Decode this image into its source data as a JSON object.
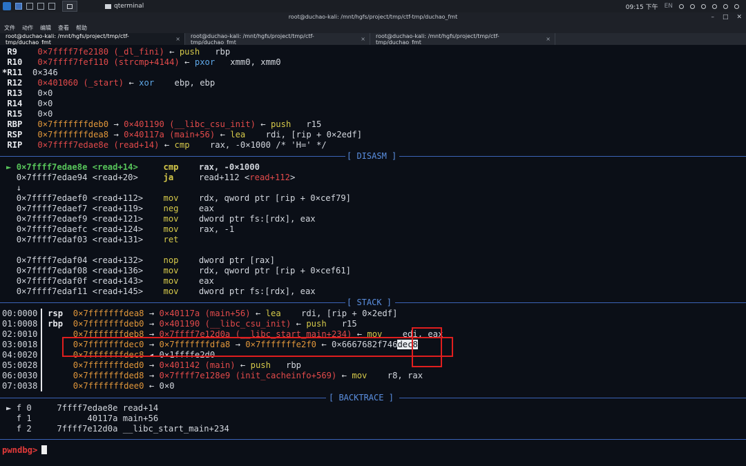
{
  "panel": {
    "task_title": "qterminal",
    "time": "09:15 下午",
    "lang": "EN"
  },
  "window": {
    "title": "root@duchao-kali: /mnt/hgfs/project/tmp/ctf-tmp/duchao_fmt",
    "menu": [
      "文件",
      "动作",
      "编辑",
      "查看",
      "帮助"
    ],
    "tabs": [
      {
        "label": "root@duchao-kali: /mnt/hgfs/project/tmp/ctf-tmp/duchao_fmt",
        "active": true
      },
      {
        "label": "root@duchao-kali: /mnt/hgfs/project/tmp/ctf-tmp/duchao_fmt",
        "active": false
      },
      {
        "label": "root@duchao-kali: /mnt/hgfs/project/tmp/ctf-tmp/duchao_fmt",
        "active": false
      }
    ],
    "close_glyph": "×"
  },
  "registers": [
    {
      "mark": " ",
      "name": "R9 ",
      "value": "0×7ffff7fe2180 (_dl_fini)",
      "arrow": "←",
      "op": "push",
      "args": "rbp"
    },
    {
      "mark": " ",
      "name": "R10",
      "value": "0×7ffff7fef110 (strcmp+4144)",
      "arrow": "←",
      "op": "pxor",
      "args": "xmm0, xmm0"
    },
    {
      "mark": "*",
      "name": "R11",
      "value": "0×346"
    },
    {
      "mark": " ",
      "name": "R12",
      "value": "0×401060 (_start)",
      "arrow": "←",
      "op": "xor",
      "args": "ebp, ebp"
    },
    {
      "mark": " ",
      "name": "R13",
      "value": "0×0"
    },
    {
      "mark": " ",
      "name": "R14",
      "value": "0×0"
    },
    {
      "mark": " ",
      "name": "R15",
      "value": "0×0"
    },
    {
      "mark": " ",
      "name": "RBP",
      "value": "0×7fffffffdeb0",
      "arrow": "→",
      "value2": "0×401190 (__libc_csu_init)",
      "arrow2": "←",
      "op": "push",
      "args": "r15"
    },
    {
      "mark": " ",
      "name": "RSP",
      "value": "0×7fffffffdea8",
      "arrow": "→",
      "value2": "0×40117a (main+56)",
      "arrow2": "←",
      "op": "lea",
      "args": "rdi, [rip + 0×2edf]"
    },
    {
      "mark": " ",
      "name": "RIP",
      "value": "0×7ffff7edae8e (read+14)",
      "arrow": "←",
      "op": "cmp",
      "args": "rax, -0×1000 /* 'H=' */"
    }
  ],
  "sections": {
    "disasm": "[ DISASM ]",
    "stack": "[ STACK ]",
    "backtrace": "[ BACKTRACE ]"
  },
  "disasm": [
    {
      "current": true,
      "addr": "0×7ffff7edae8e",
      "sym": "<read+14>",
      "op": "cmp",
      "args": "rax, -0×1000"
    },
    {
      "addr": "0×7ffff7edae94",
      "sym": "<read+20>",
      "op": "ja",
      "args": "read+112",
      "target": "<read+112>"
    },
    {
      "down": "↓"
    },
    {
      "addr": "0×7ffff7edaef0",
      "sym": "<read+112>",
      "op": "mov",
      "args": "rdx, qword ptr [rip + 0×cef79]"
    },
    {
      "addr": "0×7ffff7edaef7",
      "sym": "<read+119>",
      "op": "neg",
      "args": "eax"
    },
    {
      "addr": "0×7ffff7edaef9",
      "sym": "<read+121>",
      "op": "mov",
      "args": "dword ptr fs:[rdx], eax"
    },
    {
      "addr": "0×7ffff7edaefc",
      "sym": "<read+124>",
      "op": "mov",
      "args": "rax, -1"
    },
    {
      "addr": "0×7ffff7edaf03",
      "sym": "<read+131>",
      "op": "ret",
      "args": ""
    },
    {
      "blank": true
    },
    {
      "addr": "0×7ffff7edaf04",
      "sym": "<read+132>",
      "op": "nop",
      "args": "dword ptr [rax]"
    },
    {
      "addr": "0×7ffff7edaf08",
      "sym": "<read+136>",
      "op": "mov",
      "args": "rdx, qword ptr [rip + 0×cef61]"
    },
    {
      "addr": "0×7ffff7edaf0f",
      "sym": "<read+143>",
      "op": "mov",
      "args": "eax"
    },
    {
      "addr": "0×7ffff7edaf11",
      "sym": "<read+145>",
      "op": "mov",
      "args": "dword ptr fs:[rdx], eax"
    }
  ],
  "stack": [
    {
      "idx": "00:0000",
      "reg": "rsp",
      "addr": "0×7fffffffdea8",
      "a1": "→",
      "v1": "0×40117a (main+56)",
      "a2": "←",
      "op": "lea",
      "args": "rdi, [rip + 0×2edf]"
    },
    {
      "idx": "01:0008",
      "reg": "rbp",
      "addr": "0×7fffffffdeb0",
      "a1": "→",
      "v1": "0×401190 (__libc_csu_init)",
      "a2": "←",
      "op": "push",
      "args": "r15"
    },
    {
      "idx": "02:0010",
      "reg": "",
      "addr": "0×7fffffffdeb8",
      "a1": "→",
      "v1": "0×7ffff7e12d0a (__libc_start_main+234)",
      "a2": "←",
      "op": "mov",
      "args": "edi, eax"
    },
    {
      "idx": "03:0018",
      "reg": "",
      "addr": "0×7fffffffdec0",
      "a1": "→",
      "v1": "0×7fffffffdfa8",
      "a2": "→",
      "v2": "0×7fffffffe2f0",
      "a3": "←",
      "v3": "0×6667682f746",
      "sel": "dec8"
    },
    {
      "idx": "04:0020",
      "reg": "",
      "addr": "0×7fffffffdec8",
      "a1": "◂",
      "v1": "0×1ffffe2d0"
    },
    {
      "idx": "05:0028",
      "reg": "",
      "addr": "0×7fffffffded0",
      "a1": "→",
      "v1": "0×401142 (main)",
      "a2": "←",
      "op": "push",
      "args": "rbp"
    },
    {
      "idx": "06:0030",
      "reg": "",
      "addr": "0×7fffffffded8",
      "a1": "→",
      "v1": "0×7ffff7e128e9 (init_cacheinfo+569)",
      "a2": "←",
      "op": "mov",
      "args": "r8, rax"
    },
    {
      "idx": "07:0038",
      "reg": "",
      "addr": "0×7fffffffdee0",
      "a1": "←",
      "v1": "0×0"
    }
  ],
  "backtrace": [
    {
      "mark": "►",
      "frame": "f 0",
      "addr": "7ffff7edae8e",
      "sym": "read+14"
    },
    {
      "mark": " ",
      "frame": "f 1",
      "addr": "      40117a",
      "sym": "main+56"
    },
    {
      "mark": " ",
      "frame": "f 2",
      "addr": "7ffff7e12d0a",
      "sym": "__libc_start_main+234"
    }
  ],
  "prompt": "pwndbg>",
  "current_marker": "►"
}
